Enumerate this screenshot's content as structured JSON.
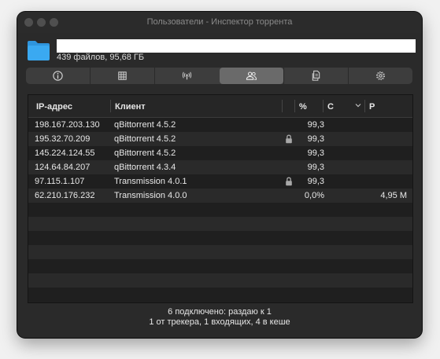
{
  "window": {
    "title": "Пользователи - Инспектор торрента",
    "name_field_value": "",
    "subtitle": "439 файлов, 95,68 ГБ"
  },
  "tabs": [
    {
      "icon": "info-icon",
      "active": false
    },
    {
      "icon": "grid-icon",
      "active": false
    },
    {
      "icon": "antenna-icon",
      "active": false
    },
    {
      "icon": "peers-icon",
      "active": true
    },
    {
      "icon": "files-icon",
      "active": false
    },
    {
      "icon": "gear-icon",
      "active": false
    }
  ],
  "table": {
    "headers": {
      "ip": "IP-адрес",
      "client": "Клиент",
      "percent": "%",
      "c": "С",
      "p": "Р"
    },
    "rows": [
      {
        "ip": "198.167.203.130",
        "client": "qBittorrent 4.5.2",
        "locked": false,
        "percent": "99,3",
        "c": "",
        "p": ""
      },
      {
        "ip": "195.32.70.209",
        "client": "qBittorrent 4.5.2",
        "locked": true,
        "percent": "99,3",
        "c": "",
        "p": ""
      },
      {
        "ip": "145.224.124.55",
        "client": "qBittorrent 4.5.2",
        "locked": false,
        "percent": "99,3",
        "c": "",
        "p": ""
      },
      {
        "ip": "124.64.84.207",
        "client": "qBittorrent 4.3.4",
        "locked": false,
        "percent": "99,3",
        "c": "",
        "p": ""
      },
      {
        "ip": "97.115.1.107",
        "client": "Transmission 4.0.1",
        "locked": true,
        "percent": "99,3",
        "c": "",
        "p": ""
      },
      {
        "ip": "62.210.176.232",
        "client": "Transmission 4.0.0",
        "locked": false,
        "percent": "0,0%",
        "c": "",
        "p": "4,95 M"
      }
    ]
  },
  "footer": {
    "line1": "6 подключено: раздаю к 1",
    "line2": "1 от трекера, 1 входящих, 4 в кеше"
  },
  "colors": {
    "window_bg": "#2a2a2a",
    "folder_blue": "#39a9f0",
    "active_tab": "#6a6a6a"
  }
}
